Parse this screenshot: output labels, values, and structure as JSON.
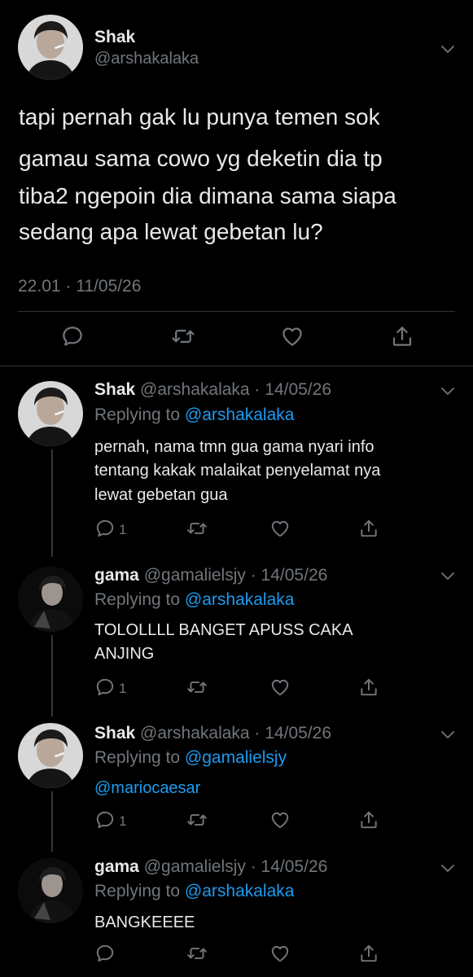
{
  "main": {
    "name": "Shak",
    "handle": "@arshakalaka",
    "text": [
      "tapi pernah gak lu punya temen sok",
      "gamau sama cowo yg deketin dia tp",
      "tiba2 ngepoin dia dimana sama siapa",
      "sedang apa lewat gebetan lu?"
    ],
    "timestamp": "22.01 · 11/05/26"
  },
  "replies": [
    {
      "name": "Shak",
      "meta": "@arshakalaka · 14/05/26",
      "replying_prefix": "Replying to",
      "replying_to": "@arshakalaka",
      "text": [
        "pernah, nama tmn gua gama nyari info",
        "tentang kakak malaikat penyelamat nya",
        "lewat gebetan gua"
      ],
      "reply_count": "1"
    },
    {
      "name": "gama",
      "meta": "@gamalielsjy · 14/05/26",
      "replying_prefix": "Replying to",
      "replying_to": "@arshakalaka",
      "text": [
        "TOLOLLLL BANGET APUSS CAKA",
        "ANJING"
      ],
      "reply_count": "1"
    },
    {
      "name": "Shak",
      "meta": "@arshakalaka · 14/05/26",
      "replying_prefix": "Replying to",
      "replying_to": "@gamalielsjy",
      "mention": "@mariocaesar",
      "reply_count": "1"
    },
    {
      "name": "gama",
      "meta": "@gamalielsjy · 14/05/26",
      "replying_prefix": "Replying to",
      "replying_to": "@arshakalaka",
      "text": [
        "BANGKEEEE"
      ],
      "reply_count": ""
    }
  ],
  "icons": {
    "reply": "reply-icon",
    "retweet": "retweet-icon",
    "like": "like-icon",
    "share": "share-icon",
    "more": "chevron-down-icon"
  },
  "colors": {
    "background": "#000000",
    "text": "#e7e9ea",
    "muted": "#71767b",
    "link": "#1d9bf0"
  }
}
